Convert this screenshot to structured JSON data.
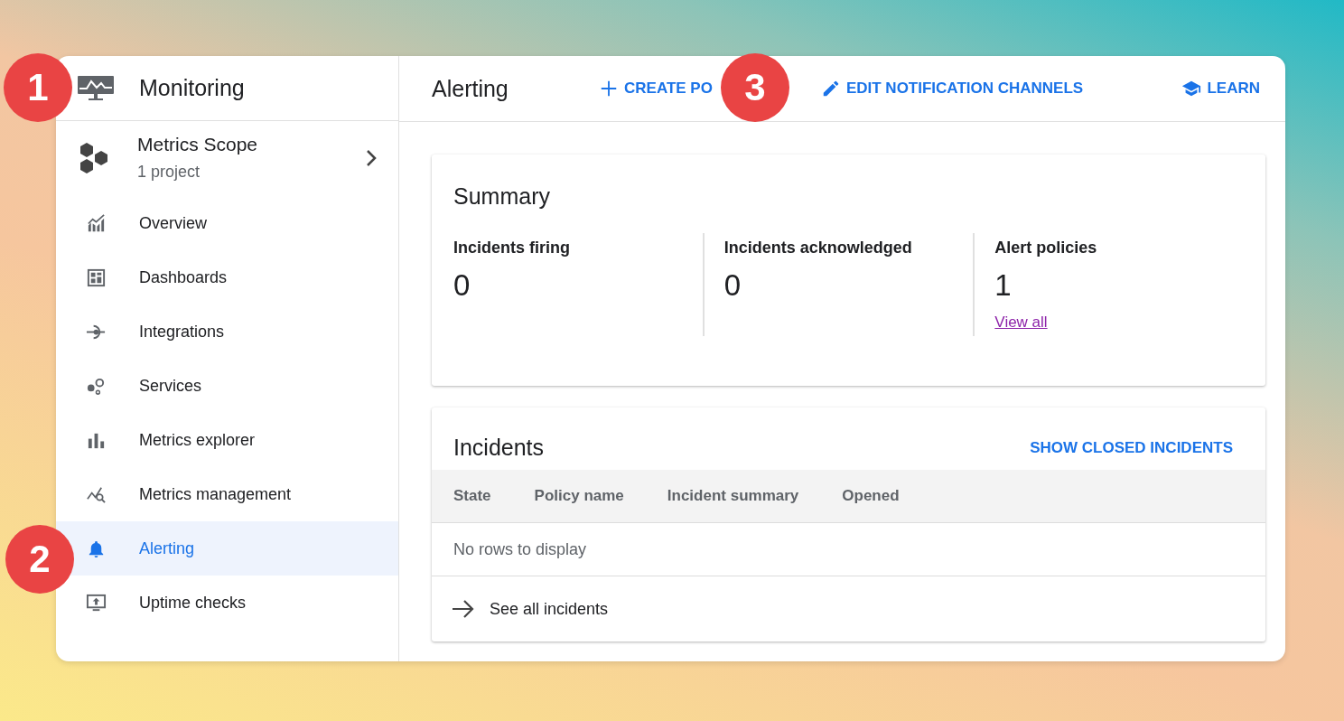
{
  "app": {
    "title": "Monitoring"
  },
  "scope": {
    "title": "Metrics Scope",
    "subtitle": "1 project"
  },
  "sidebar": {
    "items": [
      {
        "label": "Overview",
        "selected": false
      },
      {
        "label": "Dashboards",
        "selected": false
      },
      {
        "label": "Integrations",
        "selected": false
      },
      {
        "label": "Services",
        "selected": false
      },
      {
        "label": "Metrics explorer",
        "selected": false
      },
      {
        "label": "Metrics management",
        "selected": false
      },
      {
        "label": "Alerting",
        "selected": true
      },
      {
        "label": "Uptime checks",
        "selected": false
      }
    ]
  },
  "header": {
    "title": "Alerting",
    "actions": [
      "CREATE PO",
      "EDIT NOTIFICATION CHANNELS",
      "LEARN"
    ]
  },
  "summary": {
    "title": "Summary",
    "stats": [
      {
        "label": "Incidents firing",
        "value": "0"
      },
      {
        "label": "Incidents acknowledged",
        "value": "0"
      },
      {
        "label": "Alert policies",
        "value": "1",
        "link": "View all"
      }
    ]
  },
  "incidents": {
    "title": "Incidents",
    "action": "SHOW CLOSED INCIDENTS",
    "table": {
      "columns": [
        "State",
        "Policy name",
        "Incident summary",
        "Opened"
      ],
      "empty": "No rows to display"
    },
    "footer_link": "See all incidents"
  },
  "callouts": [
    "1",
    "2",
    "3"
  ]
}
